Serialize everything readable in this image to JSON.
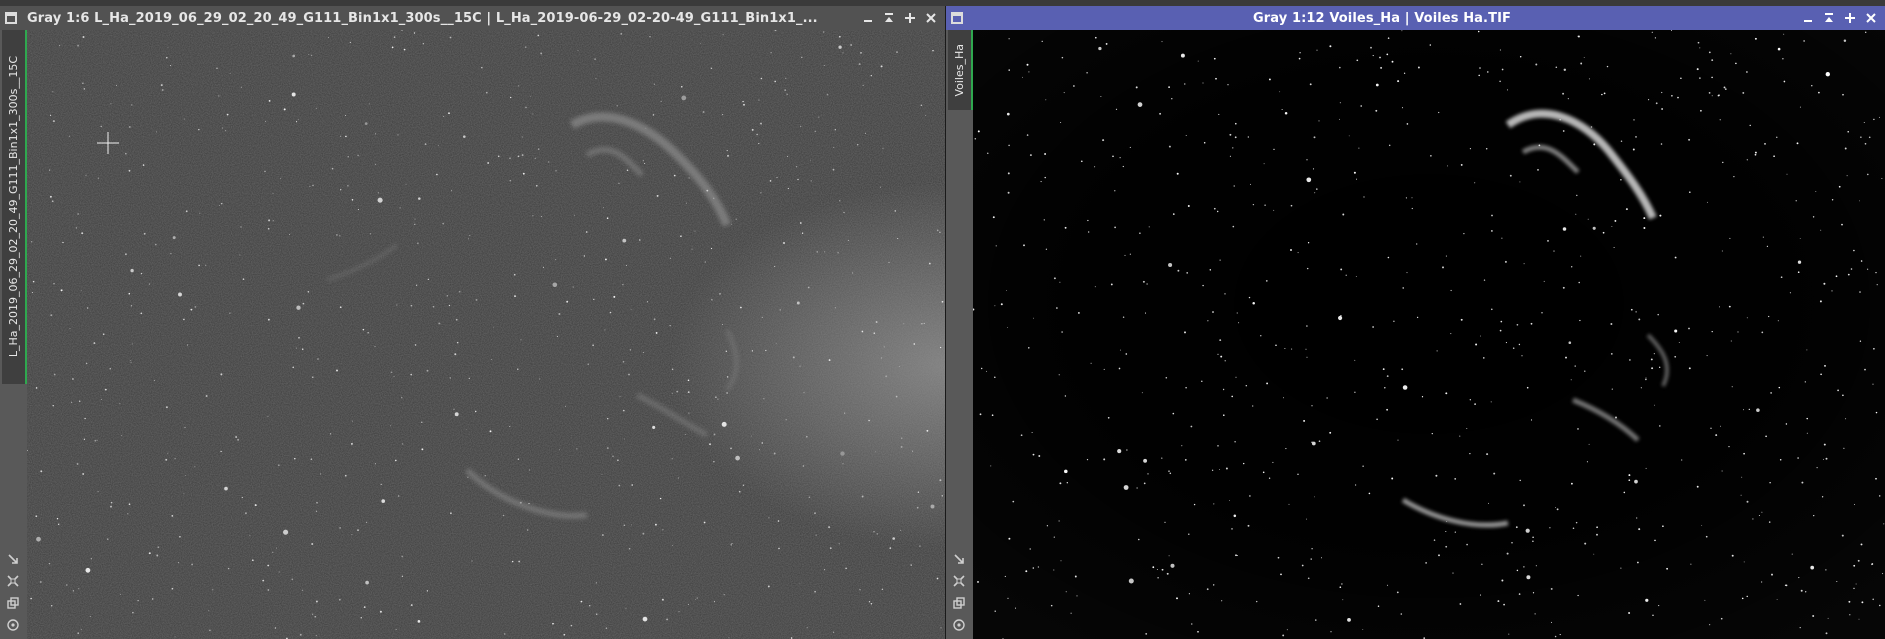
{
  "windows": {
    "left": {
      "title": "Gray 1:6 L_Ha_2019_06_29_02_20_49_G111_Bin1x1_300s__15C | L_Ha_2019-06-29_02-20-49_G111_Bin1x1_...",
      "side_label": "L_Ha_2019_06_29_02_20_49_G111_Bin1x1_300s__15C",
      "state": "inactive",
      "zoom": "1:6"
    },
    "right": {
      "title": "Gray 1:12 Voiles_Ha | Voiles Ha.TIF",
      "side_label": "Voiles_Ha",
      "state": "active",
      "zoom": "1:12"
    }
  },
  "controls": [
    "minimize-icon",
    "shade-icon",
    "maximize-icon",
    "close-icon"
  ],
  "sidebar_tools": [
    "fit-view-icon",
    "zoom-to-fit-icon",
    "stack-icon",
    "cursor-mode-icon"
  ],
  "colors": {
    "active_titlebar": "#5960b2",
    "inactive_titlebar": "#525252",
    "selection_tab": "#2fa84f",
    "background_left": "#3c3c3c",
    "background_right": "#080808"
  }
}
